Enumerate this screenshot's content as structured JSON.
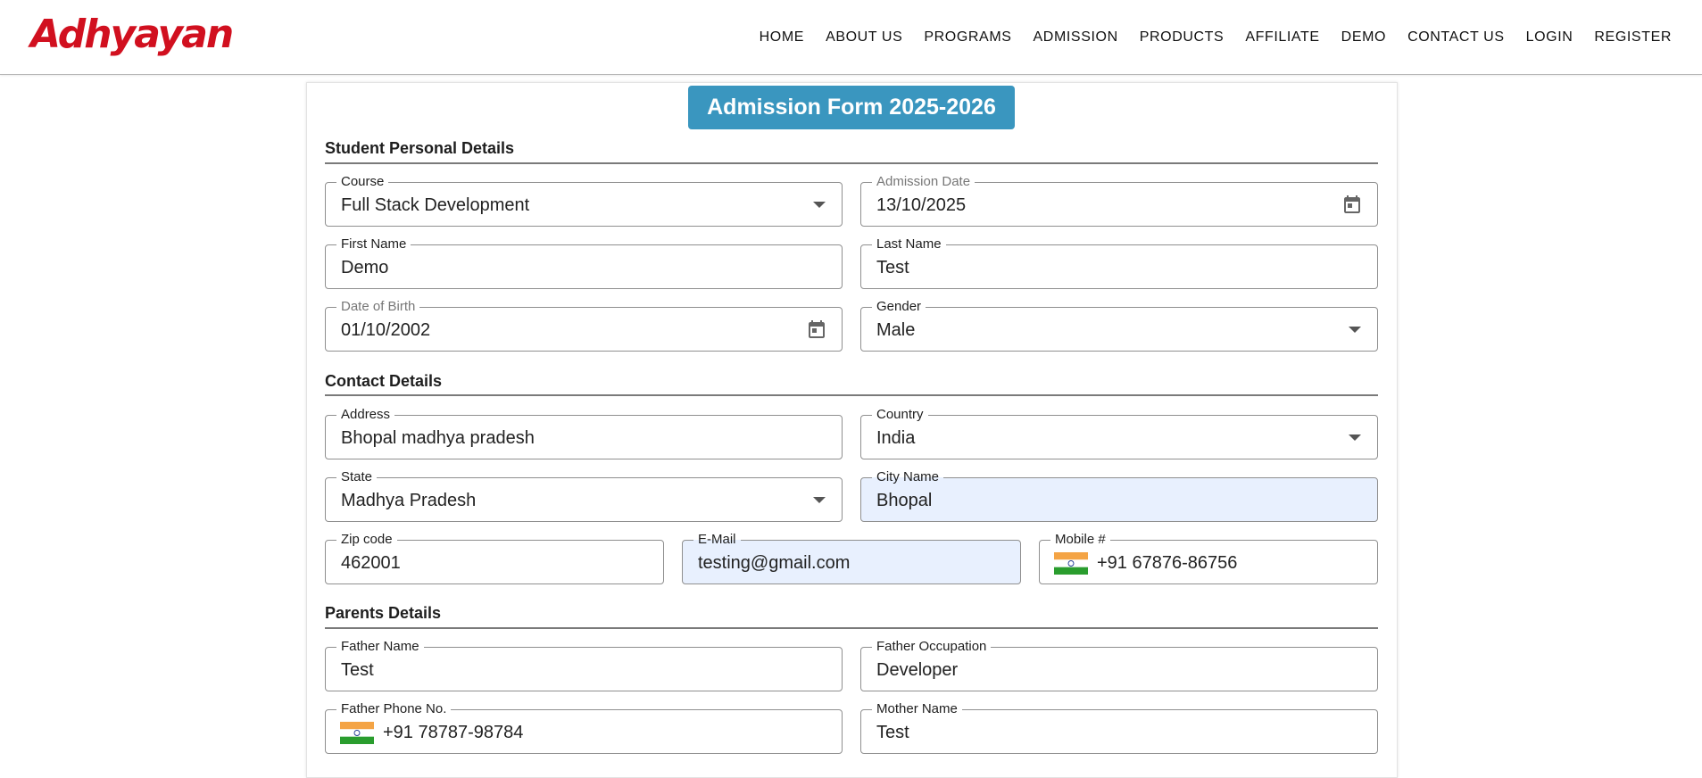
{
  "brand": {
    "logo": "Adhyayan"
  },
  "nav": [
    "HOME",
    "ABOUT US",
    "PROGRAMS",
    "ADMISSION",
    "PRODUCTS",
    "AFFILIATE",
    "DEMO",
    "CONTACT US",
    "LOGIN",
    "REGISTER"
  ],
  "form": {
    "title": "Admission Form 2025-2026",
    "sections": {
      "personal": "Student Personal Details",
      "contact": "Contact Details",
      "parents": "Parents Details"
    },
    "fields": {
      "course": {
        "label": "Course",
        "value": "Full Stack Development"
      },
      "admission_date": {
        "label": "Admission Date",
        "value": "13/10/2025"
      },
      "first_name": {
        "label": "First Name",
        "value": "Demo"
      },
      "last_name": {
        "label": "Last Name",
        "value": "Test"
      },
      "dob": {
        "label": "Date of Birth",
        "value": "01/10/2002"
      },
      "gender": {
        "label": "Gender",
        "value": "Male"
      },
      "address": {
        "label": "Address",
        "value": "Bhopal madhya pradesh"
      },
      "country": {
        "label": "Country",
        "value": "India"
      },
      "state": {
        "label": "State",
        "value": "Madhya Pradesh"
      },
      "city": {
        "label": "City Name",
        "value": "Bhopal"
      },
      "zip": {
        "label": "Zip code",
        "value": "462001"
      },
      "email": {
        "label": "E-Mail",
        "value": "testing@gmail.com"
      },
      "mobile": {
        "label": "Mobile #",
        "value": "+91 67876-86756"
      },
      "father_name": {
        "label": "Father Name",
        "value": "Test"
      },
      "father_occupation": {
        "label": "Father Occupation",
        "value": "Developer"
      },
      "father_phone": {
        "label": "Father Phone No.",
        "value": "+91 78787-98784"
      },
      "mother_name": {
        "label": "Mother Name",
        "value": "Test"
      }
    }
  },
  "colors": {
    "brand_red": "#d1101f",
    "title_blue": "#3a96bf",
    "autofill_bg": "#e8f0fe"
  },
  "icons": {
    "calendar": "calendar-icon",
    "dropdown": "chevron-down-icon",
    "flag": "india-flag-icon"
  }
}
